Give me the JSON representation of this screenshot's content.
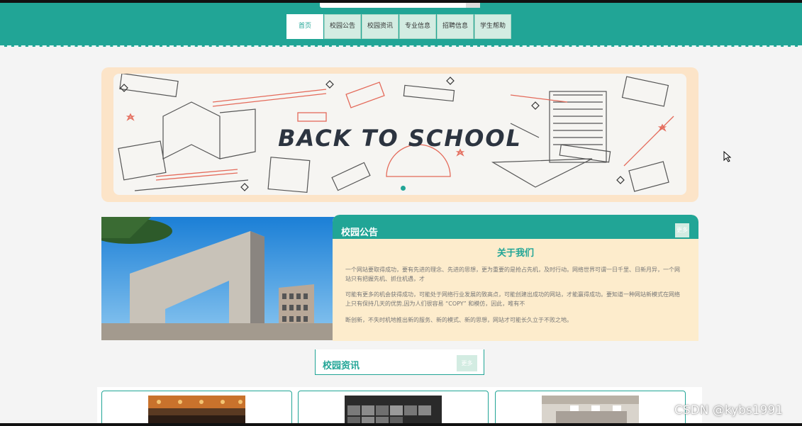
{
  "nav": {
    "items": [
      "首页",
      "校园公告",
      "校园资讯",
      "专业信息",
      "招聘信息",
      "学生帮助"
    ],
    "active_index": 0
  },
  "banner": {
    "title": "BACK TO SCHOOL"
  },
  "notice": {
    "title": "校园公告",
    "more": "更多",
    "about_title": "关于我们",
    "paragraphs": [
      "一个网站要取得成功，要有先进的理念、先进的思想，更为重要的是抢占先机，及时行动。网络世界可谓一日千里、日新月异，一个网站只有把握先机、抓住机遇，才",
      "可能有更多的机会获得成功，可能处于网络行业发展的致高点，可能创建出成功的网站，才能赢得成功。要知道一种网站新模式在网络上只有保持几天的优势,因为人们很容易 “COPY” 和模仿，因此，唯有不",
      "断创新，不失时机地推出新的服务、新的模式、新的思想，网站才可能长久立于不败之地。"
    ]
  },
  "news": {
    "title": "校园资讯",
    "more": "更多"
  },
  "watermark": "CSDN @kybs1991",
  "colors": {
    "primary": "#21a596",
    "banner_bg": "#fce4c8",
    "notice_bg": "#fdeccc"
  }
}
